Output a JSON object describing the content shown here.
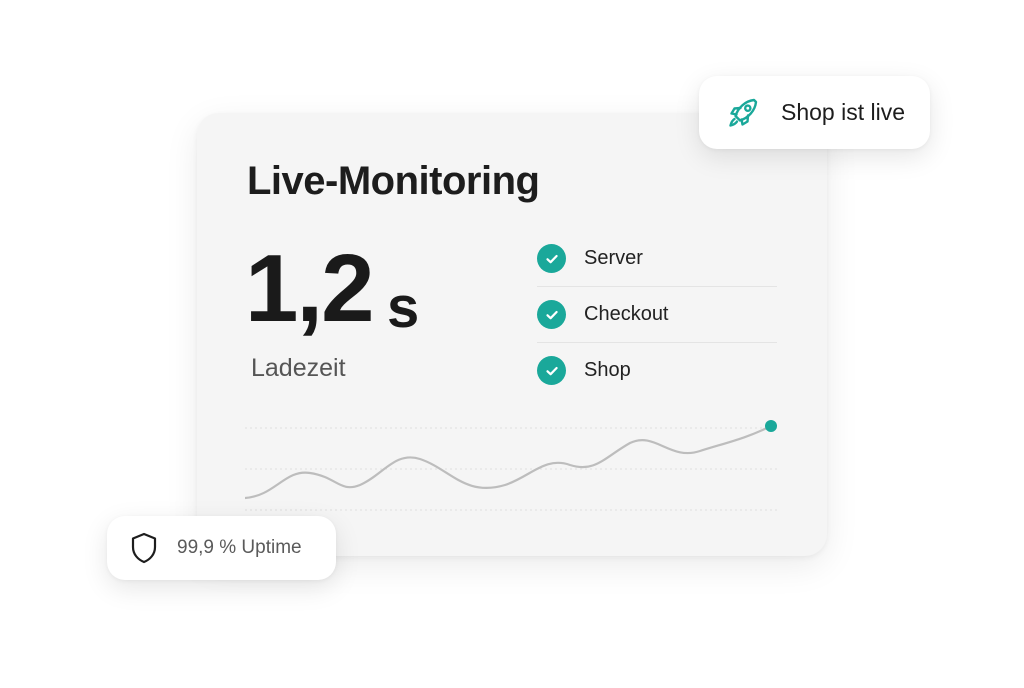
{
  "card": {
    "title": "Live-Monitoring",
    "metric": {
      "value": "1,2",
      "unit": "s",
      "label": "Ladezeit"
    },
    "status_items": [
      {
        "label": "Server",
        "state": "ok"
      },
      {
        "label": "Checkout",
        "state": "ok"
      },
      {
        "label": "Shop",
        "state": "ok"
      }
    ],
    "sparkline": {
      "trend": "rising",
      "endpoint_marker": true
    }
  },
  "badges": {
    "live": {
      "icon": "rocket-icon",
      "text": "Shop ist live"
    },
    "uptime": {
      "icon": "shield-icon",
      "text": "99,9 % Uptime"
    }
  },
  "colors": {
    "accent": "#1aa89a",
    "card_background": "#f5f5f5",
    "text_primary": "#1d1d1d",
    "text_secondary": "#555555",
    "line": "#bdbdbd"
  }
}
